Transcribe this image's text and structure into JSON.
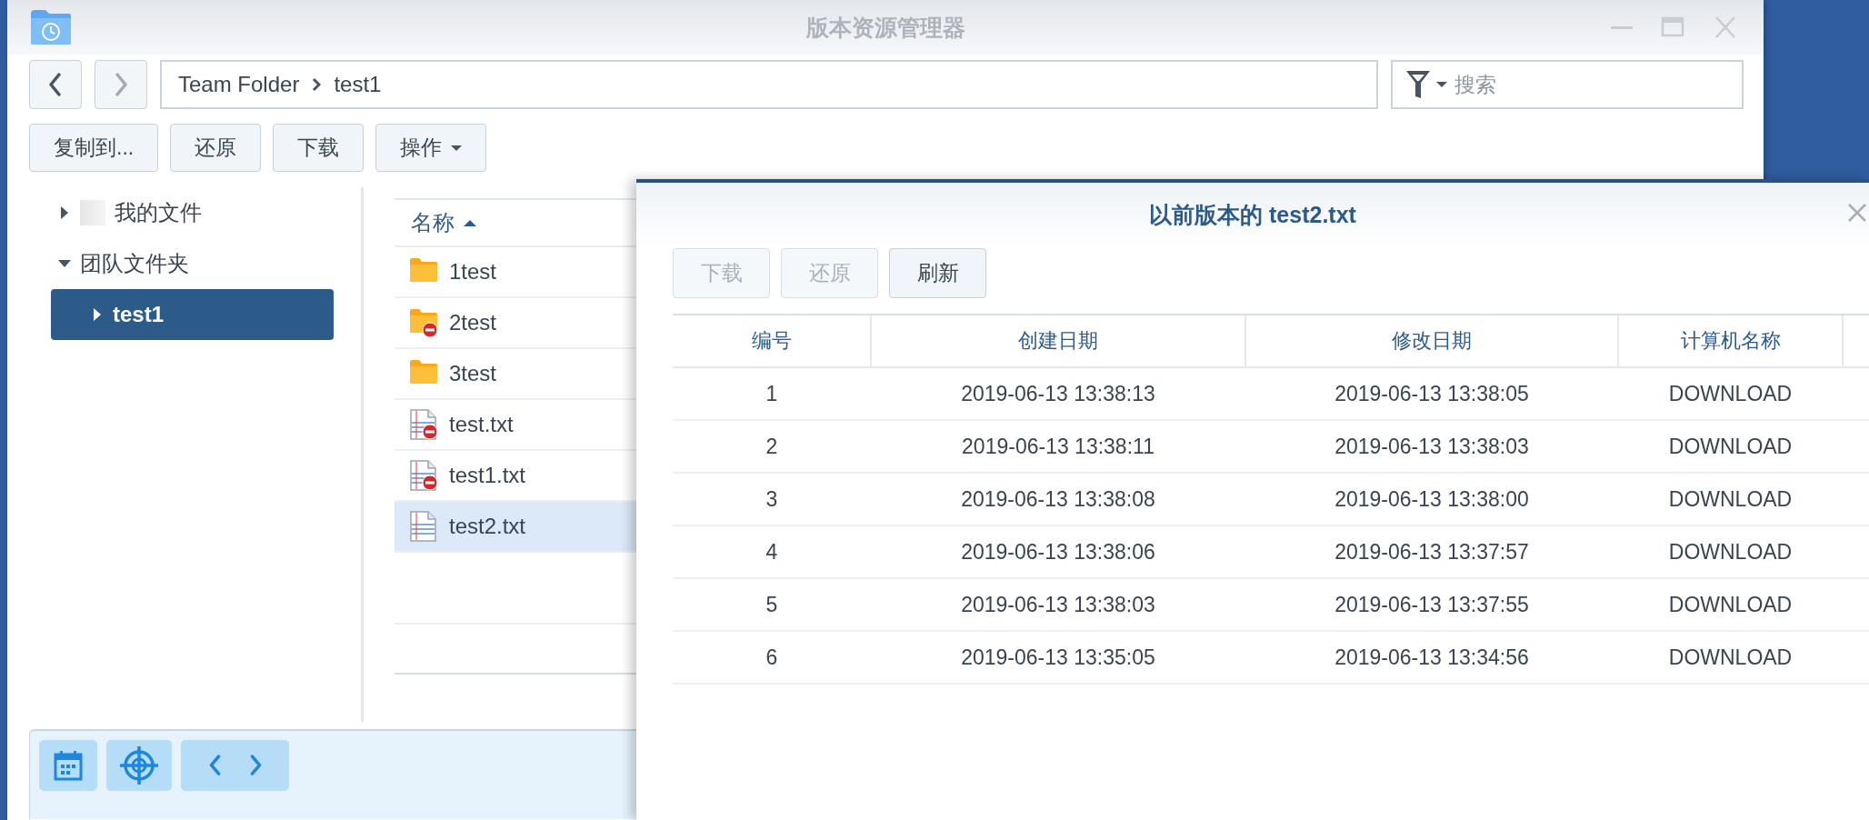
{
  "window": {
    "title": "版本资源管理器"
  },
  "navigation": {
    "path": [
      "Team Folder",
      "test1"
    ],
    "search": {
      "placeholder": "搜索"
    }
  },
  "toolbar": [
    {
      "label": "复制到...",
      "kind": "button"
    },
    {
      "label": "还原",
      "kind": "button"
    },
    {
      "label": "下载",
      "kind": "button"
    },
    {
      "label": "操作",
      "kind": "menu"
    }
  ],
  "tree": [
    {
      "label": "我的文件",
      "kind": "personal",
      "expanded": false,
      "selected": false
    },
    {
      "label": "团队文件夹",
      "kind": "group",
      "expanded": true,
      "selected": false,
      "children": [
        {
          "label": "test1",
          "expanded": false,
          "selected": true
        }
      ]
    }
  ],
  "file_list": {
    "columns": [
      {
        "label": "名称",
        "sorted": true
      }
    ],
    "rows": [
      {
        "name": "1test",
        "kind": "folder",
        "restricted": false,
        "selected": false
      },
      {
        "name": "2test",
        "kind": "folder",
        "restricted": true,
        "selected": false
      },
      {
        "name": "3test",
        "kind": "folder",
        "restricted": false,
        "selected": false
      },
      {
        "name": "test.txt",
        "kind": "text",
        "restricted": true,
        "selected": false
      },
      {
        "name": "test1.txt",
        "kind": "text",
        "restricted": true,
        "selected": false
      },
      {
        "name": "test2.txt",
        "kind": "text",
        "restricted": false,
        "selected": true
      }
    ]
  },
  "dialog": {
    "title": "以前版本的 test2.txt",
    "buttons": [
      {
        "label": "下载",
        "disabled": true
      },
      {
        "label": "还原",
        "disabled": true
      },
      {
        "label": "刷新",
        "disabled": false
      }
    ],
    "table": {
      "columns": [
        "编号",
        "创建日期",
        "修改日期",
        "计算机名称"
      ],
      "rows": [
        [
          "1",
          "2019-06-13 13:38:13",
          "2019-06-13 13:38:05",
          "DOWNLOAD"
        ],
        [
          "2",
          "2019-06-13 13:38:11",
          "2019-06-13 13:38:03",
          "DOWNLOAD"
        ],
        [
          "3",
          "2019-06-13 13:38:08",
          "2019-06-13 13:38:00",
          "DOWNLOAD"
        ],
        [
          "4",
          "2019-06-13 13:38:06",
          "2019-06-13 13:37:57",
          "DOWNLOAD"
        ],
        [
          "5",
          "2019-06-13 13:38:03",
          "2019-06-13 13:37:55",
          "DOWNLOAD"
        ],
        [
          "6",
          "2019-06-13 13:35:05",
          "2019-06-13 13:34:56",
          "DOWNLOAD"
        ]
      ]
    }
  }
}
